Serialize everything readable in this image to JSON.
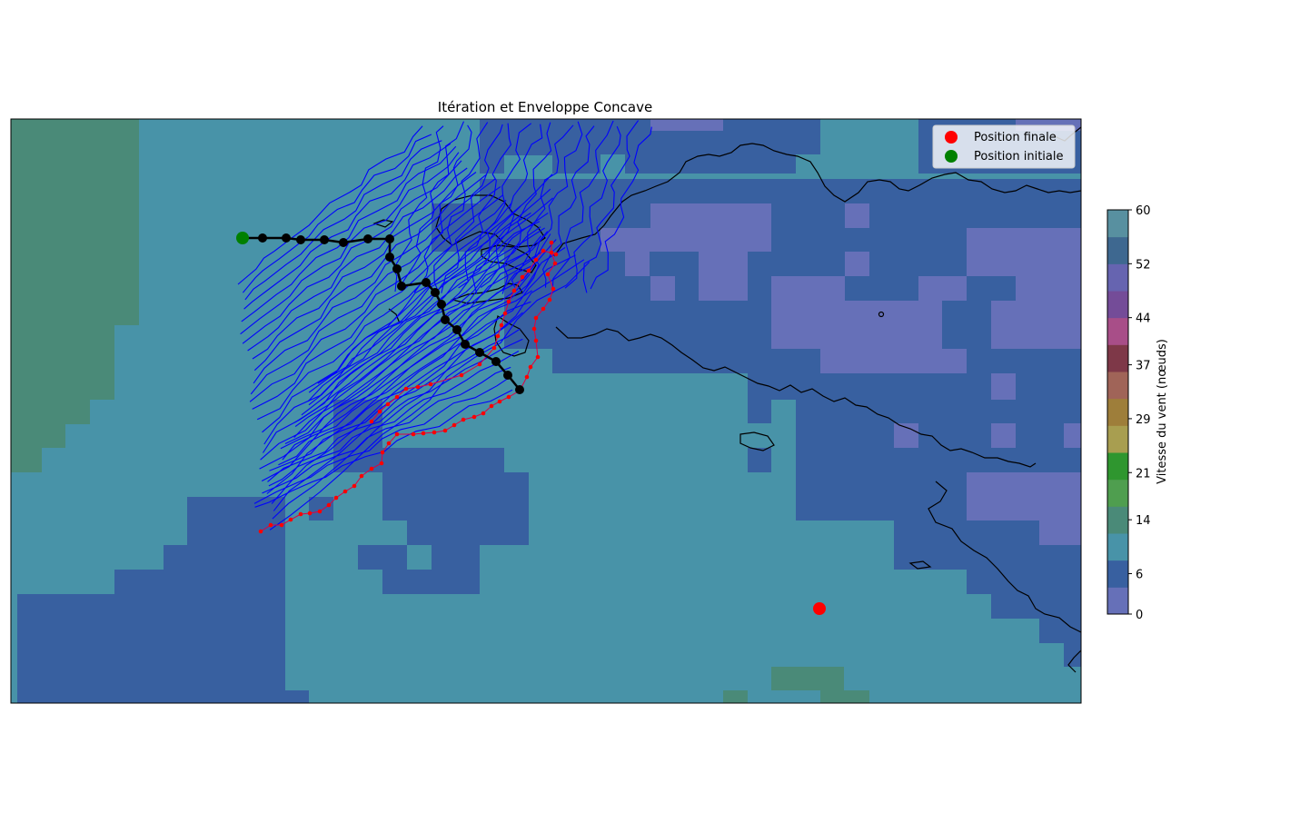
{
  "chart_data": {
    "type": "heatmap",
    "title": "Itération et Enveloppe Concave",
    "colorbar": {
      "label": "Vitesse du vent (nœuds)",
      "range": [
        0,
        60
      ],
      "tick_labels": [
        "0",
        "6",
        "14",
        "21",
        "29",
        "37",
        "44",
        "52",
        "60"
      ],
      "band_colors": [
        "#6670b8",
        "#3860a0",
        "#4893a8",
        "#4a8a78",
        "#4f9e4f",
        "#2f962f",
        "#a89e50",
        "#9e7e3a",
        "#a06458",
        "#7e3848",
        "#a84e88",
        "#744c98",
        "#6664b0",
        "#3e6890",
        "#5890a0"
      ]
    },
    "legend": {
      "position": "top-right",
      "entries": [
        {
          "label": "Position finale",
          "color": "#ff0000"
        },
        {
          "label": "Position initiale",
          "color": "#008000"
        }
      ]
    },
    "colors": {
      "trajectories": "#0000ff",
      "envelope": "#dd0044",
      "path": "#000000",
      "coast": "#000000"
    },
    "initial_position": {
      "label": "Position initiale"
    },
    "final_position": {
      "label": "Position finale"
    }
  }
}
